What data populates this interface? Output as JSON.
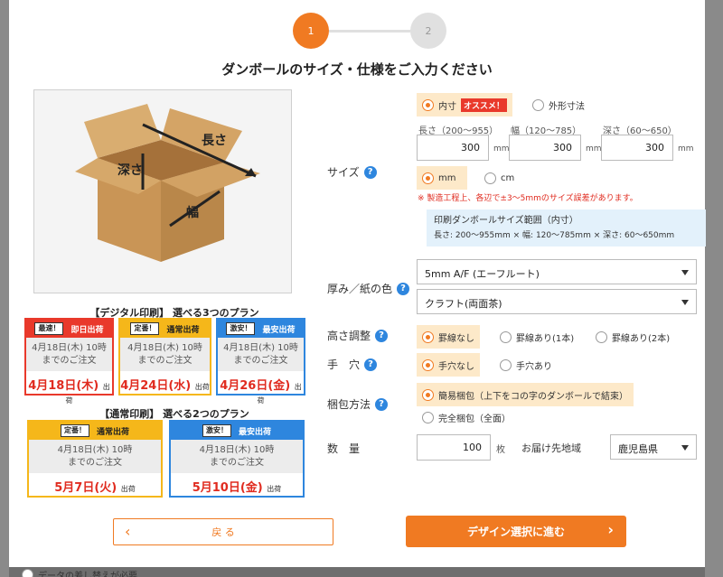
{
  "stepper": {
    "step1": "1",
    "step2": "2"
  },
  "title": "ダンボールのサイズ・仕様をご入力ください",
  "illustration": {
    "length_label": "長さ",
    "depth_label": "深さ",
    "width_label": "幅"
  },
  "plans3": {
    "heading": "【デジタル印刷】 選べる3つのプラン",
    "cards": [
      {
        "tag": "最速！",
        "name": "即日出荷",
        "deadline_line1": "4月18日(木) 10時",
        "deadline_line2": "までのご注文",
        "ship_date": "4月18日(木)",
        "ship_suffix": "出荷"
      },
      {
        "tag": "定番！",
        "name": "通常出荷",
        "deadline_line1": "4月18日(木) 10時",
        "deadline_line2": "までのご注文",
        "ship_date": "4月24日(水)",
        "ship_suffix": "出荷"
      },
      {
        "tag": "激安！",
        "name": "最安出荷",
        "deadline_line1": "4月18日(木) 10時",
        "deadline_line2": "までのご注文",
        "ship_date": "4月26日(金)",
        "ship_suffix": "出荷"
      }
    ]
  },
  "plans2": {
    "heading": "【通常印刷】 選べる2つのプラン",
    "cards": [
      {
        "tag": "定番！",
        "name": "通常出荷",
        "deadline_line1": "4月18日(木) 10時",
        "deadline_line2": "までのご注文",
        "ship_date": "5月7日(火)",
        "ship_suffix": "出荷"
      },
      {
        "tag": "激安！",
        "name": "最安出荷",
        "deadline_line1": "4月18日(木) 10時",
        "deadline_line2": "までのご注文",
        "ship_date": "5月10日(金)",
        "ship_suffix": "出荷"
      }
    ]
  },
  "size": {
    "label": "サイズ",
    "type_inner": "内寸",
    "recommend_badge": "オススメ！",
    "type_outer": "外形寸法",
    "length_label": "長さ（200～955）",
    "width_label": "幅（120～785）",
    "depth_label": "深さ（60～650）",
    "length_value": "300",
    "width_value": "300",
    "depth_value": "300",
    "unit": "mm",
    "unit_mm": "mm",
    "unit_cm": "cm",
    "warning": "※ 製造工程上、各辺で±3～5mmのサイズ誤差があります。",
    "range_title": "印刷ダンボールサイズ範囲（内寸）",
    "range_text": "長さ: 200～955mm × 幅: 120～785mm × 深さ: 60～650mm"
  },
  "thickness": {
    "label": "厚み／紙の色",
    "value": "5mm A/F (エーフルート)",
    "color_value": "クラフト(両面茶)"
  },
  "height_adjust": {
    "label": "高さ調整",
    "opt1": "罫線なし",
    "opt2": "罫線あり(1本)",
    "opt3": "罫線あり(2本)"
  },
  "handhole": {
    "label": "手　穴",
    "opt1": "手穴なし",
    "opt2": "手穴あり"
  },
  "packing": {
    "label": "梱包方法",
    "opt1": "簡易梱包（上下をコの字のダンボールで結束）",
    "opt2": "完全梱包（全面）"
  },
  "quantity": {
    "label": "数　量",
    "value": "100",
    "unit": "枚",
    "dest_label": "お届け先地域",
    "dest_value": "鹿児島県"
  },
  "buttons": {
    "back": "戻 る",
    "next": "デザイン選択に進む",
    "back_chevron": "‹",
    "next_chevron": "›"
  },
  "bottom_hint": "データの差し替えが必要",
  "colors": {
    "accent": "#f07a22",
    "red": "#e9392b",
    "yellow": "#f5b71a",
    "blue": "#2e86de"
  }
}
